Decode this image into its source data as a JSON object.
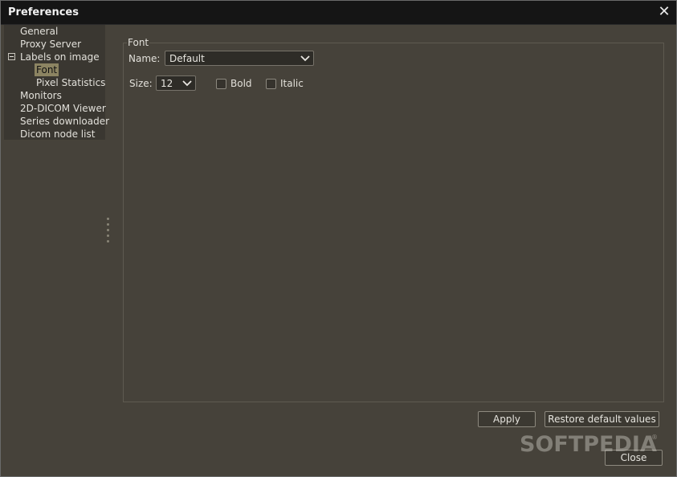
{
  "window": {
    "title": "Preferences",
    "close_symbol": "✕"
  },
  "tree": {
    "items": [
      {
        "label": "General",
        "selected": false
      },
      {
        "label": "Proxy Server",
        "selected": false
      },
      {
        "label": "Labels on image",
        "selected": false,
        "expanded": true
      },
      {
        "label": "Font",
        "selected": true
      },
      {
        "label": "Pixel Statistics",
        "selected": false
      },
      {
        "label": "Monitors",
        "selected": false
      },
      {
        "label": "2D-DICOM Viewer",
        "selected": false
      },
      {
        "label": "Series downloader",
        "selected": false
      },
      {
        "label": "Dicom node list",
        "selected": false
      }
    ]
  },
  "font_panel": {
    "legend": "Font",
    "name_label": "Name:",
    "name_value": "Default",
    "size_label": "Size:",
    "size_value": "12",
    "bold_label": "Bold",
    "bold_checked": false,
    "italic_label": "Italic",
    "italic_checked": false
  },
  "buttons": {
    "apply": "Apply",
    "restore": "Restore default values",
    "close": "Close"
  },
  "watermark": {
    "text": "SOFTPEDIA",
    "mark": "®"
  },
  "colors": {
    "background": "#46423a",
    "titlebar": "#151515",
    "selection": "#8c8462",
    "tree_bg": "#3a3731"
  },
  "icons": {
    "close": "close-icon",
    "dropdown": "chevron-down-icon",
    "collapse": "collapse-minus-icon",
    "splitter": "drag-handle-icon"
  }
}
